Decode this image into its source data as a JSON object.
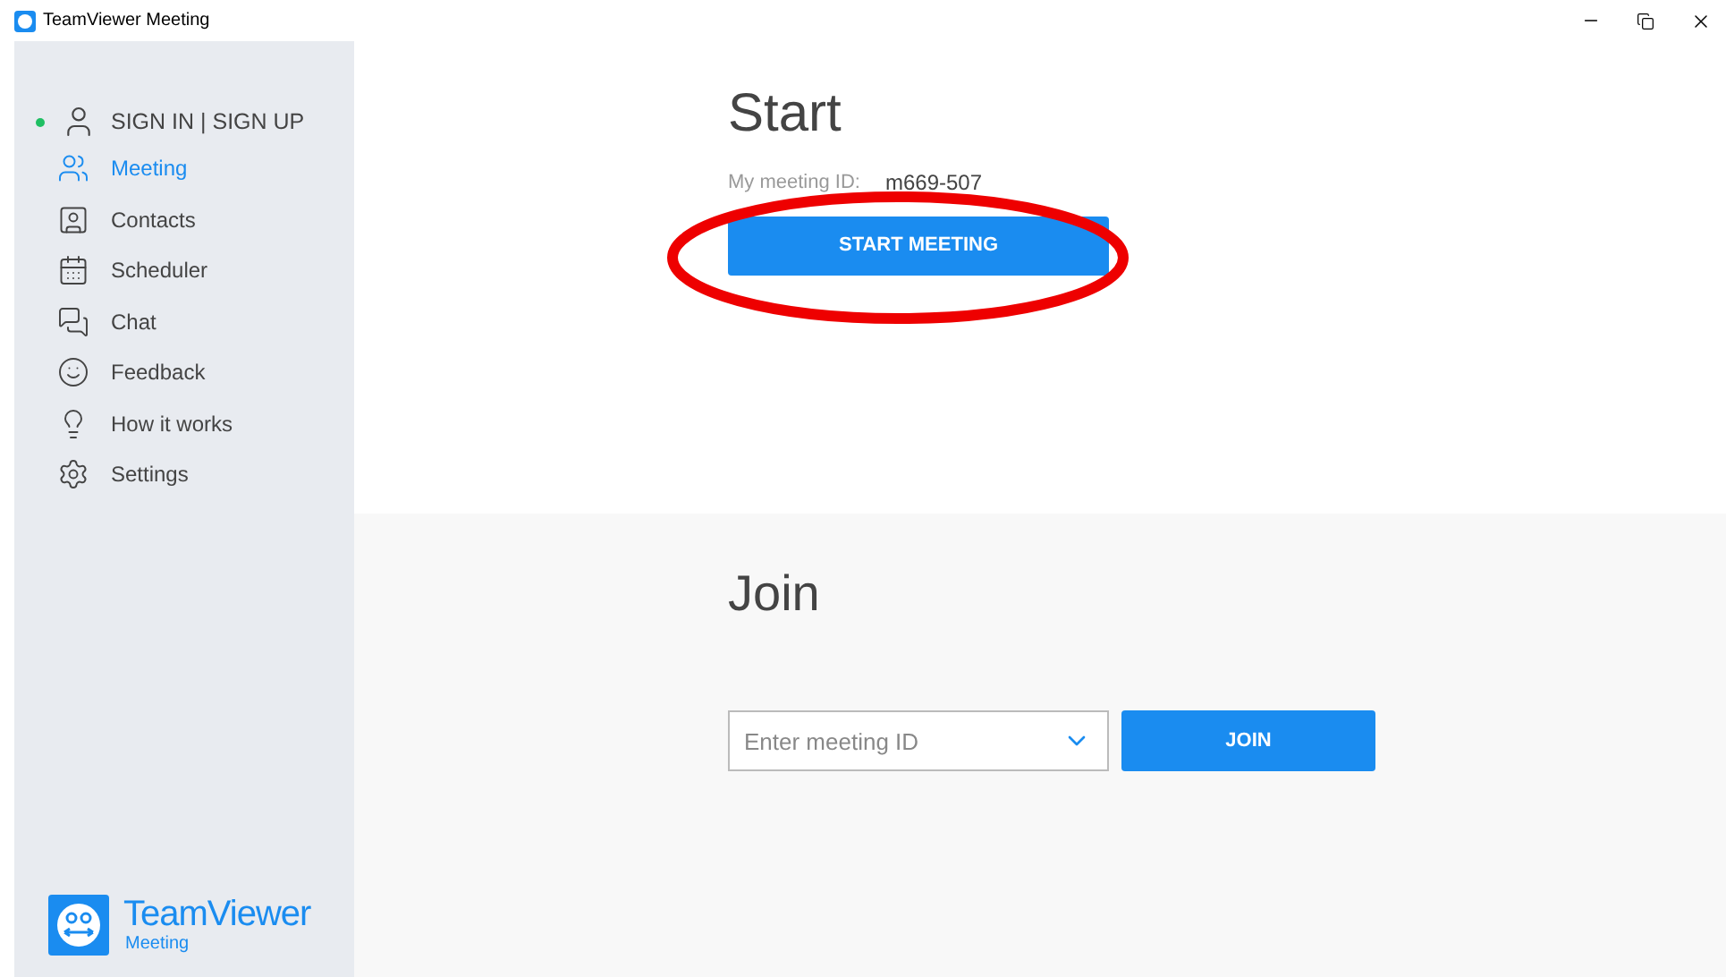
{
  "window": {
    "title": "TeamViewer Meeting"
  },
  "sidebar": {
    "account": {
      "label": "SIGN IN | SIGN UP",
      "online": true
    },
    "items": [
      {
        "label": "Meeting",
        "selected": true
      },
      {
        "label": "Contacts",
        "selected": false
      },
      {
        "label": "Scheduler",
        "selected": false
      },
      {
        "label": "Chat",
        "selected": false
      },
      {
        "label": "Feedback",
        "selected": false
      },
      {
        "label": "How it works",
        "selected": false
      },
      {
        "label": "Settings",
        "selected": false
      }
    ],
    "logo": {
      "name": "TeamViewer",
      "subtitle": "Meeting"
    }
  },
  "start": {
    "title": "Start",
    "meeting_id_label": "My meeting ID:",
    "meeting_id": "m669-507",
    "button": "START MEETING"
  },
  "join": {
    "title": "Join",
    "placeholder": "Enter meeting ID",
    "button": "JOIN"
  }
}
